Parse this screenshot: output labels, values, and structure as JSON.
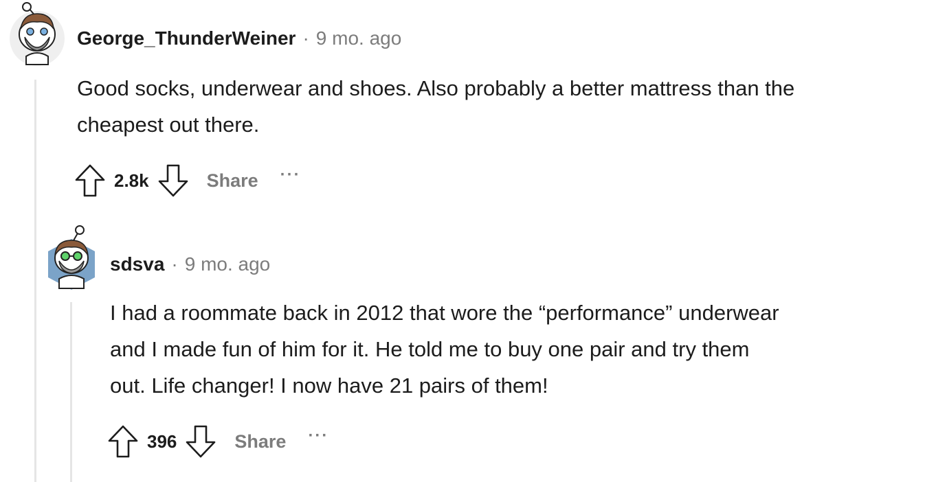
{
  "comments": [
    {
      "author": "George_ThunderWeiner",
      "separator": "·",
      "time": "9 mo. ago",
      "lines": [
        "Good socks, underwear and shoes. Also probably a better mattress than the",
        "cheapest out there."
      ],
      "score": "2.8k",
      "share_label": "Share",
      "more_label": "···"
    },
    {
      "author": "sdsva",
      "separator": "·",
      "time": "9 mo. ago",
      "lines": [
        "I had a roommate back in 2012 that wore the “performance” underwear",
        "and I made fun of him for it. He told me to buy one pair and try them",
        "out. Life changer! I now have 21 pairs of them!"
      ],
      "score": "396",
      "share_label": "Share",
      "more_label": "···"
    }
  ],
  "icons": {
    "upvote": "arrow-up-outline-icon",
    "downvote": "arrow-down-outline-icon",
    "avatar_1": "snoo-avatar-bearded-icon",
    "avatar_2": "snoo-avatar-glasses-icon"
  }
}
